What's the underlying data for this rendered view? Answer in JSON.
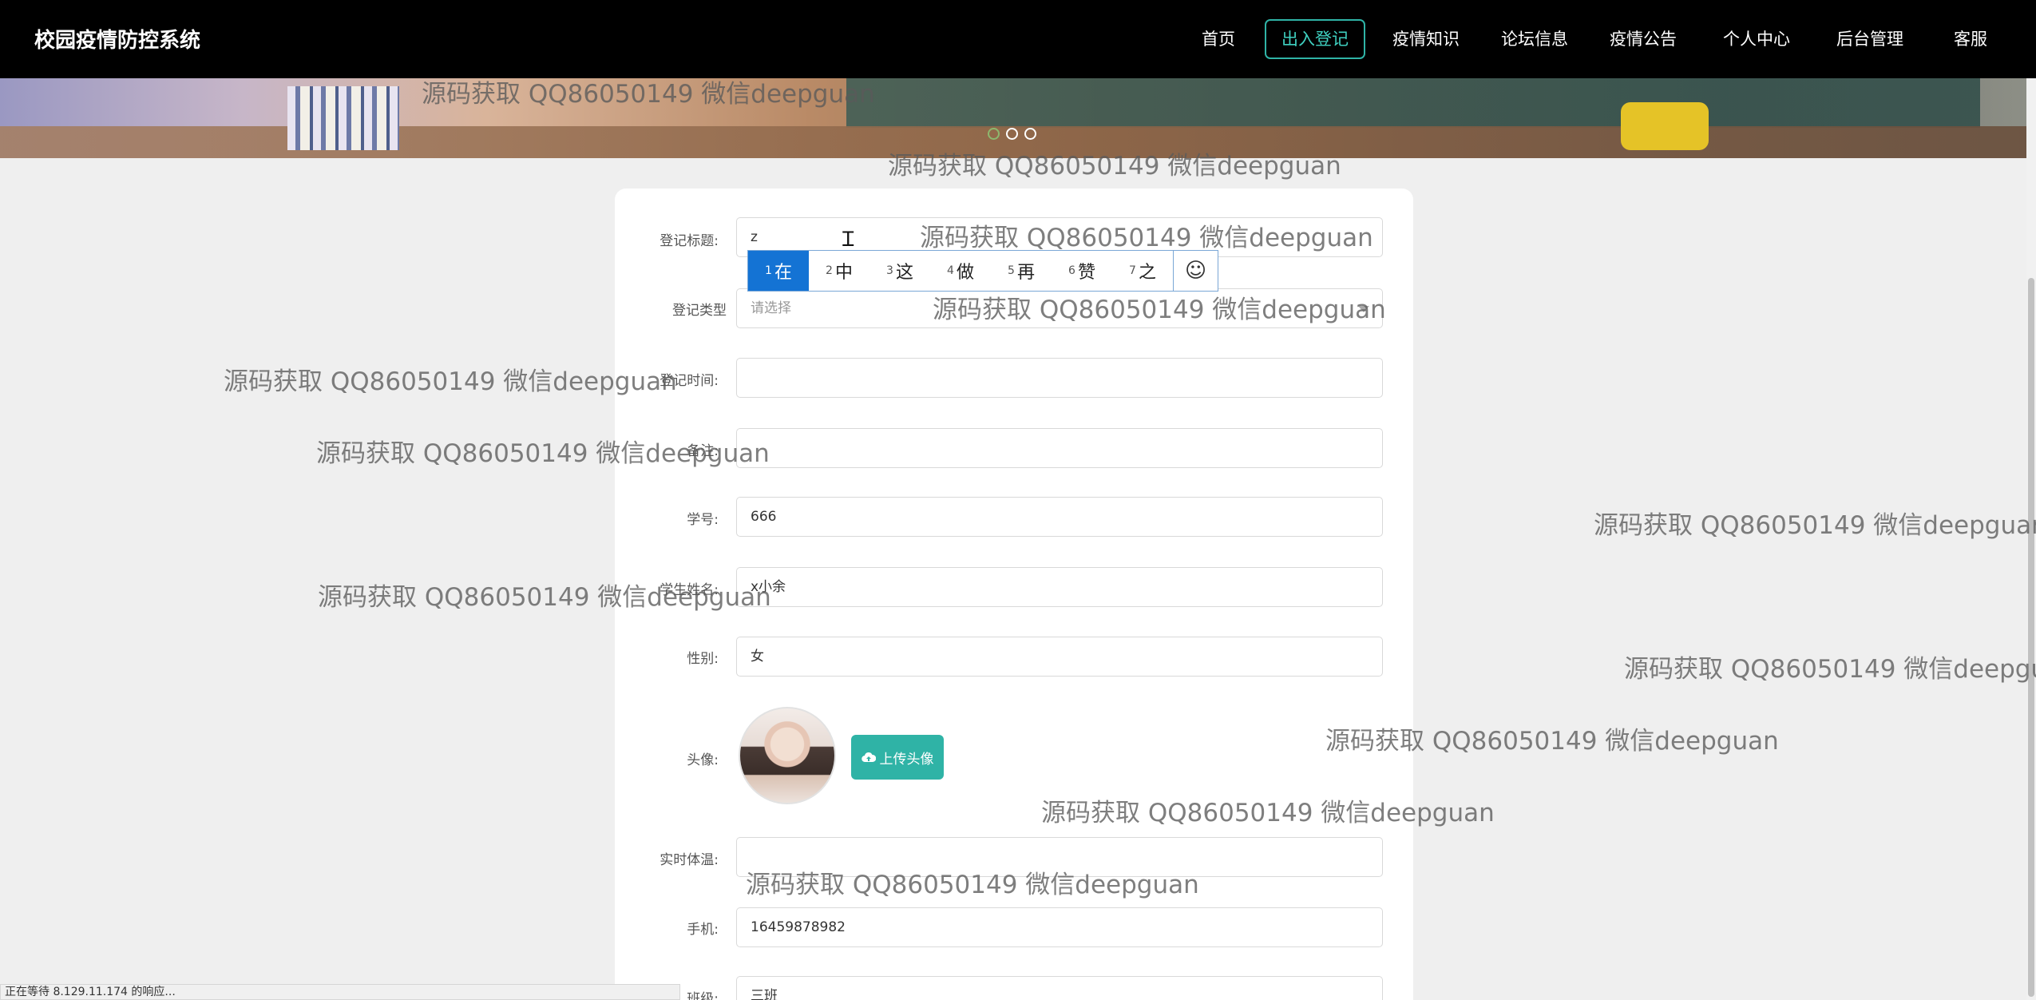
{
  "brand": "校园疫情防控系统",
  "nav": [
    {
      "label": "首页",
      "active": false
    },
    {
      "label": "出入登记",
      "active": true
    },
    {
      "label": "疫情知识",
      "active": false
    },
    {
      "label": "论坛信息",
      "active": false
    },
    {
      "label": "疫情公告",
      "active": false
    },
    {
      "label": "个人中心",
      "active": false
    },
    {
      "label": "后台管理",
      "active": false
    },
    {
      "label": "客服",
      "active": false
    }
  ],
  "carousel": {
    "slide_count": 3,
    "active_index": 0
  },
  "form": {
    "title_label": "登记标题:",
    "title_value": "z",
    "type_label": "登记类型",
    "type_placeholder": "请选择",
    "time_label": "登记时间:",
    "time_value": "",
    "remark_label": "备注:",
    "remark_value": "",
    "student_id_label": "学号:",
    "student_id_value": "666",
    "student_name_label": "学生姓名:",
    "student_name_value": "x小余",
    "gender_label": "性别:",
    "gender_value": "女",
    "avatar_label": "头像:",
    "upload_label": "上传头像",
    "temperature_label": "实时体温:",
    "temperature_value": "",
    "phone_label": "手机:",
    "phone_value": "16459878982",
    "class_label": "班级:",
    "class_value": "三班"
  },
  "ime": {
    "candidates": [
      {
        "n": "1",
        "text": "在"
      },
      {
        "n": "2",
        "text": "中"
      },
      {
        "n": "3",
        "text": "这"
      },
      {
        "n": "4",
        "text": "做"
      },
      {
        "n": "5",
        "text": "再"
      },
      {
        "n": "6",
        "text": "赞"
      },
      {
        "n": "7",
        "text": "之"
      }
    ],
    "emoji_glyph": "☺"
  },
  "watermark_text": "源码获取 QQ86050149 微信deepguan",
  "status_text": "正在等待 8.129.11.174 的响应..."
}
